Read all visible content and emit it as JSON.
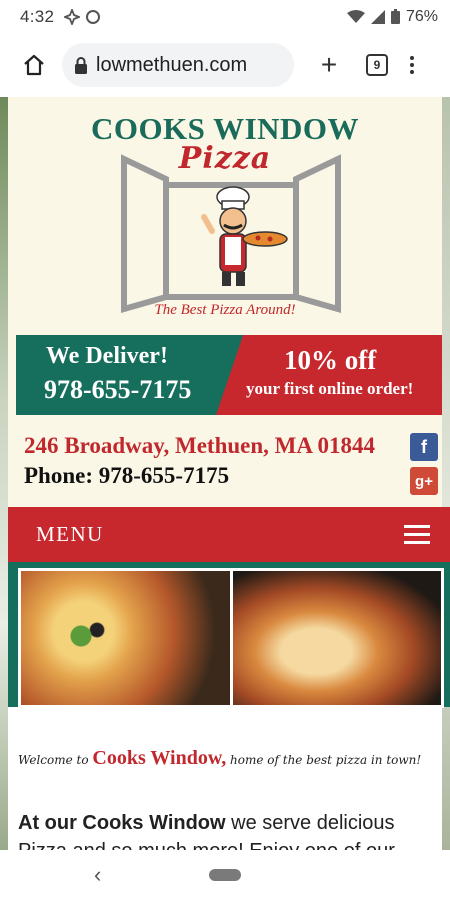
{
  "status_bar": {
    "time": "4:32",
    "battery": "76%"
  },
  "browser": {
    "url": "lowmethuen.com",
    "tab_count": "9"
  },
  "header": {
    "logo_title": "COOKS WINDOW",
    "logo_subtitle": "Pizza",
    "logo_tagline": "The Best Pizza Around!"
  },
  "promo": {
    "deliver_heading": "We Deliver!",
    "deliver_phone": "978-655-7175",
    "discount_heading": "10% off",
    "discount_text": "your first online order!"
  },
  "contact": {
    "address": "246 Broadway, Methuen, MA 01844",
    "phone": "Phone: 978-655-7175"
  },
  "nav": {
    "menu_label": "MENU"
  },
  "welcome": {
    "prefix": "Welcome to",
    "brand": "Cooks Window,",
    "suffix": "home of the best pizza in town!"
  },
  "intro": {
    "bold": "At our Cooks Window",
    "rest": " we serve delicious Pizza and so much more! Enjoy one of our"
  },
  "colors": {
    "brand_green": "#166e5d",
    "brand_red": "#c6282e",
    "cream": "#fbf7e6"
  }
}
